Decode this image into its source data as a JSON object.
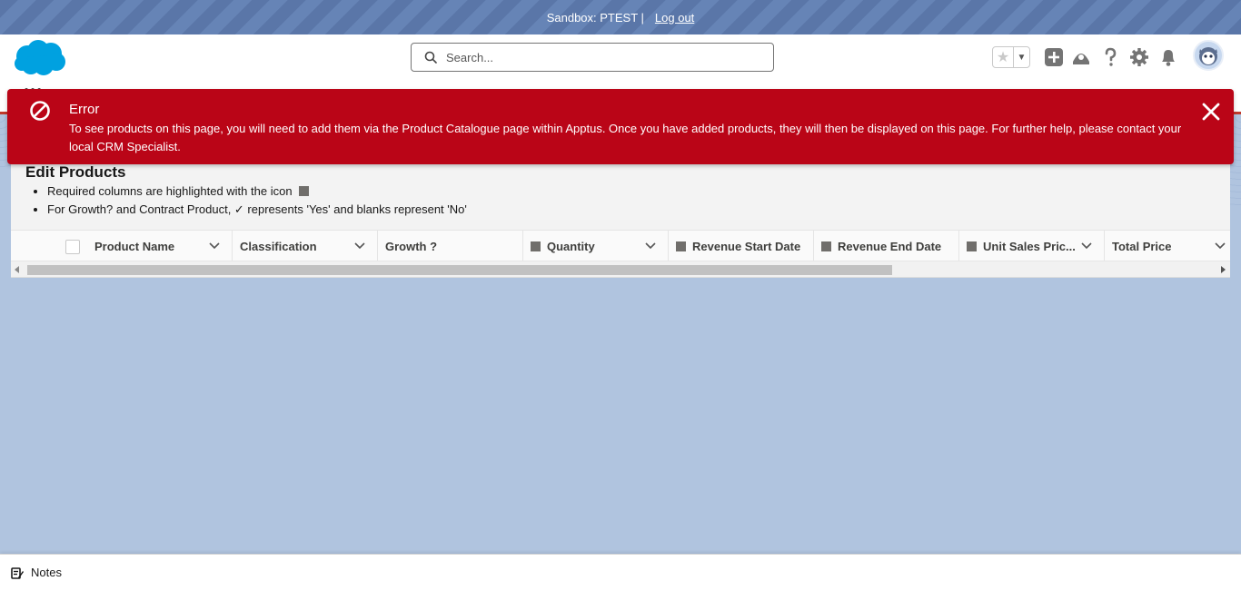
{
  "sandbox": {
    "label": "Sandbox: PTEST |",
    "logout": "Log out"
  },
  "header": {
    "search_placeholder": "Search..."
  },
  "toast": {
    "title": "Error",
    "message": "To see products on this page, you will need to add them via the Product Catalogue page within Apptus. Once you have added products, they will then be displayed on this page. For further help, please contact your local CRM Specialist."
  },
  "card": {
    "title": "Edit Products",
    "bullets": [
      "Required columns are highlighted with the icon",
      "For Growth? and Contract Product, ✓ represents 'Yes' and blanks represent 'No'"
    ]
  },
  "table": {
    "columns": [
      "Product Name",
      "Classification",
      "Growth ?",
      "Quantity",
      "Revenue Start Date",
      "Revenue End Date",
      "Unit Sales Pric...",
      "Total Price"
    ]
  },
  "utility": {
    "notes": "Notes"
  },
  "colors": {
    "error": "#ba0517",
    "brand": "#00a1e0",
    "sandbox_bar": "#5a76a8"
  }
}
